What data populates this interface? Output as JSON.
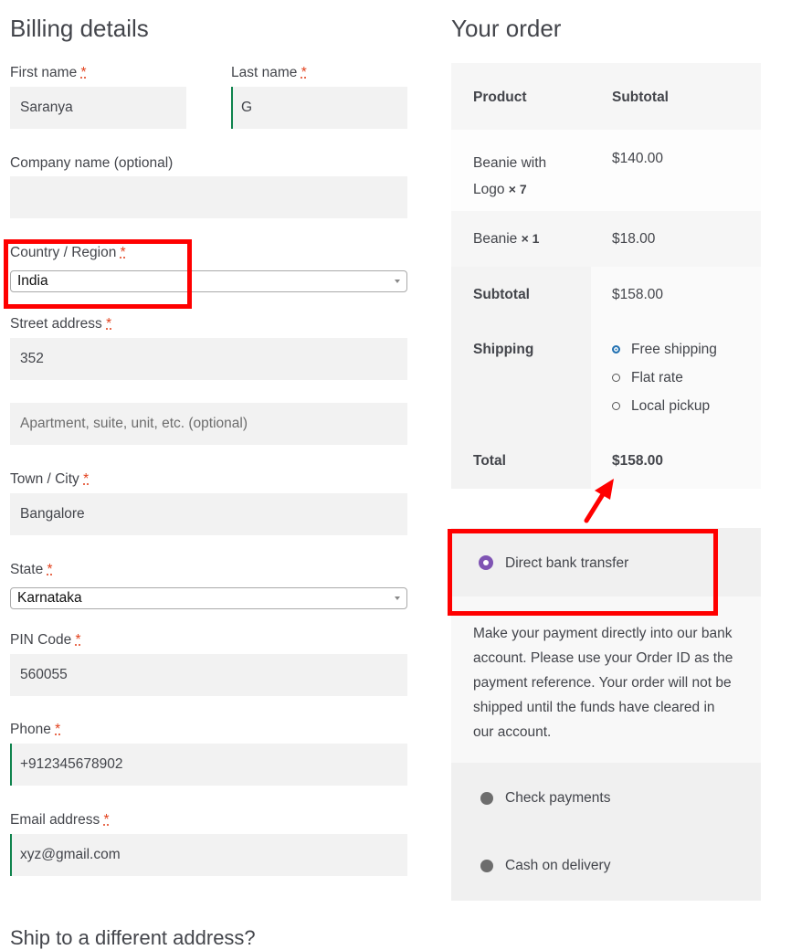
{
  "billing": {
    "title": "Billing details",
    "required_mark": "*",
    "first_name_label": "First name",
    "first_name_value": "Saranya",
    "last_name_label": "Last name",
    "last_name_value": "G",
    "company_label": "Company name (optional)",
    "company_value": "",
    "country_label": "Country / Region",
    "country_value": "India",
    "street_label": "Street address",
    "street_value": "352",
    "apartment_placeholder": "Apartment, suite, unit, etc. (optional)",
    "city_label": "Town / City",
    "city_value": "Bangalore",
    "state_label": "State",
    "state_value": "Karnataka",
    "pin_label": "PIN Code",
    "pin_value": "560055",
    "phone_label": "Phone",
    "phone_value": "+912345678902",
    "email_label": "Email address",
    "email_value": "xyz@gmail.com",
    "ship_different_partial": "Ship to a different address?"
  },
  "order": {
    "title": "Your order",
    "col_product": "Product",
    "col_subtotal": "Subtotal",
    "items": [
      {
        "name_line1": "Beanie with",
        "name_line2": "Logo",
        "qty": "× 7",
        "price": "$140.00"
      },
      {
        "name": "Beanie",
        "qty": "× 1",
        "price": "$18.00"
      }
    ],
    "subtotal_label": "Subtotal",
    "subtotal_value": "$158.00",
    "shipping_label": "Shipping",
    "shipping_options": [
      "Free shipping",
      "Flat rate",
      "Local pickup"
    ],
    "shipping_selected": "Free shipping",
    "total_label": "Total",
    "total_value": "$158.00"
  },
  "payment": {
    "selected": "Direct bank transfer",
    "methods": [
      "Direct bank transfer",
      "Check payments",
      "Cash on delivery"
    ],
    "description_lines": [
      "Make your payment directly into our bank",
      "account. Please use your Order ID as the",
      "payment reference. Your order will not be",
      "shipped until the funds have cleared in",
      "our account."
    ]
  },
  "colors": {
    "required": "#e2401c",
    "accent_border": "#0f834d",
    "annotation": "#ff0000",
    "payment_selected": "#7f54b3",
    "shipping_selected": "#2271b1"
  }
}
